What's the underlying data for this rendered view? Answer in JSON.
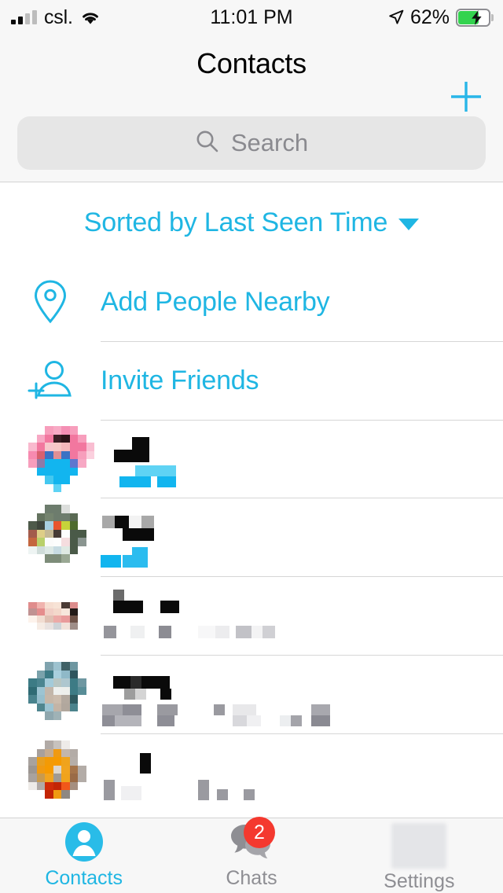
{
  "status_bar": {
    "carrier": "csl.",
    "signal_icon": "cellular-bars-icon",
    "wifi_icon": "wifi-icon",
    "time": "11:01 PM",
    "location_icon": "location-arrow-icon",
    "battery_percent": "62%",
    "battery_level": 62,
    "battery_state": "charging",
    "battery_icon": "battery-charging-icon"
  },
  "header": {
    "title": "Contacts",
    "add_icon": "plus-icon",
    "search": {
      "placeholder": "Search",
      "value": "",
      "icon": "search-icon"
    }
  },
  "sort": {
    "label": "Sorted by Last Seen Time",
    "caret_icon": "chevron-down-icon"
  },
  "actions": [
    {
      "label": "Add People Nearby",
      "icon": "location-pin-icon"
    },
    {
      "label": "Invite Friends",
      "icon": "add-person-icon"
    }
  ],
  "contacts": [
    {
      "name": "",
      "status": "",
      "name_redacted": true,
      "status_redacted": true,
      "status_color": "#21baec"
    },
    {
      "name": "",
      "status": "",
      "name_redacted": true,
      "status_redacted": true,
      "status_color": "#21baec"
    },
    {
      "name": "",
      "status": "",
      "name_redacted": true,
      "status_redacted": true,
      "status_color": "#9a9aa0"
    },
    {
      "name": "",
      "status": "",
      "name_redacted": true,
      "status_redacted": true,
      "status_color": "#9a9aa0"
    },
    {
      "name": "",
      "status": "",
      "name_redacted": true,
      "status_redacted": true,
      "status_color": "#9a9aa0"
    }
  ],
  "tabs": [
    {
      "label": "Contacts",
      "icon": "person-circle-icon",
      "active": true,
      "badge": ""
    },
    {
      "label": "Chats",
      "icon": "chat-bubbles-icon",
      "active": false,
      "badge": "2"
    },
    {
      "label": "Settings",
      "icon": "gear-icon-masked",
      "active": false,
      "badge": ""
    }
  ],
  "colors": {
    "accent": "#1fb6e3",
    "badge": "#f4392f",
    "header_bg": "#f7f7f7",
    "search_bg": "#e6e6e6",
    "separator": "#d6d6d6",
    "inactive_tab": "#8e8e93"
  }
}
